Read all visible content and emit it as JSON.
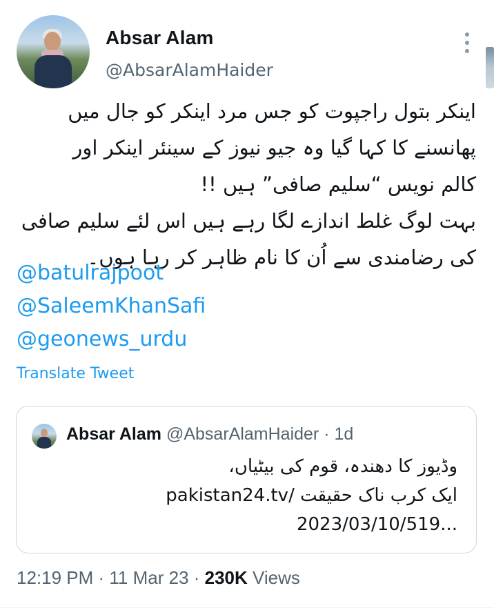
{
  "author": {
    "name": "Absar Alam",
    "handle": "@AbsarAlamHaider"
  },
  "tweet": {
    "body_lines": [
      "اینکر بتول راجپوت کو جس مرد اینکر کو جال میں",
      "پھانسنے کا کہا گیا وہ جیو نیوز کے سینئر اینکر اور",
      "کالم نویس “سلیم صافی” ہیں !!",
      "بہت لوگ غلط اندازے لگا رہے ہیں اس لئے سلیم صافی",
      "کی رضامندی سے اُن کا نام ظاہر کر رہا ہوں۔"
    ],
    "mentions": [
      "@batulrajpoot",
      "@SaleemKhanSafi",
      "@geonews_urdu"
    ],
    "translate_label": "Translate Tweet"
  },
  "quoted": {
    "name": "Absar Alam",
    "meta": " @AbsarAlamHaider · 1d",
    "line1": "وڈیوز کا دھندہ، قوم کی بیٹیاں،",
    "line2_prefix": "ایک کرب ناک حقیقت ",
    "line2_link": "pakistan24.tv/",
    "line3": "2023/03/10/519..."
  },
  "footer": {
    "meta": "12:19 PM · 11 Mar 23 · ",
    "views_count": "230K",
    "views_label": " Views"
  },
  "icons": {
    "more": "more-vertical-icon"
  },
  "colors": {
    "accent": "#1d9bf0",
    "text": "#0f1419",
    "muted": "#536471",
    "border": "#cfd9de"
  }
}
